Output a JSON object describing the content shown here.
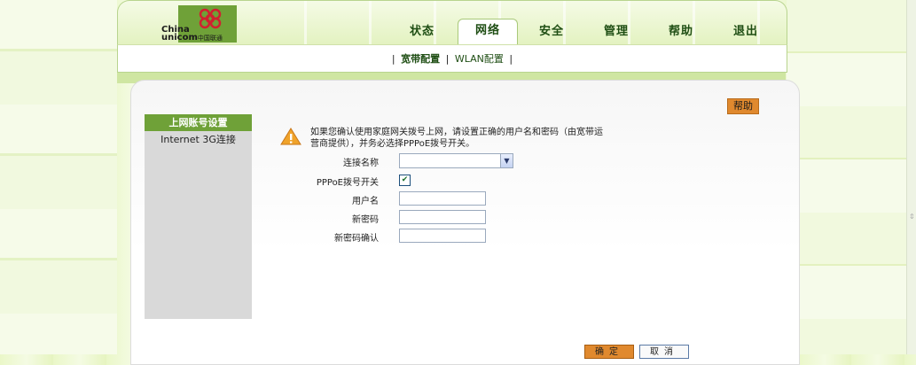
{
  "logo": {
    "line1": "China",
    "line2": "unicom",
    "cn": "中国联通"
  },
  "nav": [
    {
      "label": "状态",
      "active": false
    },
    {
      "label": "网络",
      "active": true
    },
    {
      "label": "安全",
      "active": false
    },
    {
      "label": "管理",
      "active": false
    },
    {
      "label": "帮助",
      "active": false
    },
    {
      "label": "退出",
      "active": false
    }
  ],
  "subnav": {
    "items": [
      "宽带配置",
      "WLAN配置"
    ],
    "separator": "|"
  },
  "help_button": "帮助",
  "sidebar": {
    "items": [
      "上网账号设置",
      "Internet 3G连接"
    ]
  },
  "message": "如果您确认使用家庭网关拨号上网，请设置正确的用户名和密码（由宽带运营商提供），并务必选择PPPoE拨号开关。",
  "form": {
    "connection_name_label": "连接名称",
    "connection_name_value": "",
    "pppoe_label": "PPPoE拨号开关",
    "pppoe_checked": true,
    "username_label": "用户名",
    "username_value": "",
    "password_label": "新密码",
    "password_value": "",
    "confirm_label": "新密码确认",
    "confirm_value": ""
  },
  "buttons": {
    "ok": "确定",
    "cancel": "取消"
  },
  "colors": {
    "accent_green": "#6fa138",
    "accent_orange": "#e0892e"
  }
}
